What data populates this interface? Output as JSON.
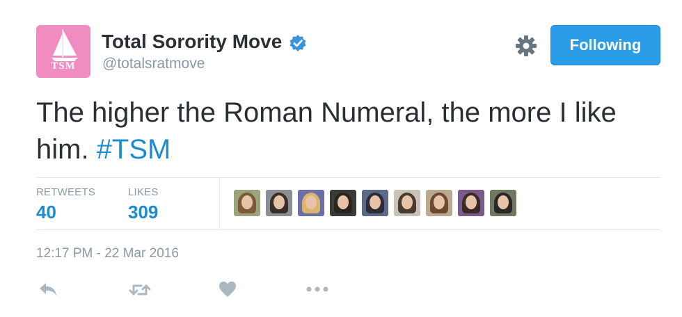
{
  "author": {
    "display_name": "Total Sorority Move",
    "handle": "@totalsratmove",
    "avatar_text": "TSM",
    "verified": true
  },
  "follow_button": {
    "label": "Following"
  },
  "tweet": {
    "text": "The higher the Roman Numeral, the more I like him. ",
    "hashtag": "#TSM"
  },
  "stats": {
    "retweets_label": "RETWEETS",
    "retweets_count": "40",
    "likes_label": "LIKES",
    "likes_count": "309"
  },
  "likers": [
    {
      "hair": "#7a5a3a",
      "bg": "#9aa37a"
    },
    {
      "hair": "#3a2e28",
      "bg": "#8a8f96"
    },
    {
      "hair": "#d9b46a",
      "bg": "#6a6fa8"
    },
    {
      "hair": "#2a2420",
      "bg": "#3a3a38"
    },
    {
      "hair": "#2e2a36",
      "bg": "#5c6a8a"
    },
    {
      "hair": "#4a3a30",
      "bg": "#c9c2b8"
    },
    {
      "hair": "#6a4a30",
      "bg": "#b9a98f"
    },
    {
      "hair": "#3a2a24",
      "bg": "#7a5a8a"
    },
    {
      "hair": "#2a2826",
      "bg": "#6e7a60"
    }
  ],
  "timestamp": "12:17 PM - 22 Mar 2016",
  "actions": [
    "reply-icon",
    "retweet-icon",
    "like-icon",
    "more-icon"
  ],
  "colors": {
    "accent": "#1b8cd0",
    "button": "#2b9ce8",
    "muted": "#8899a6",
    "verified": "#3b94d9",
    "avatar_bg": "#f08cc0"
  }
}
